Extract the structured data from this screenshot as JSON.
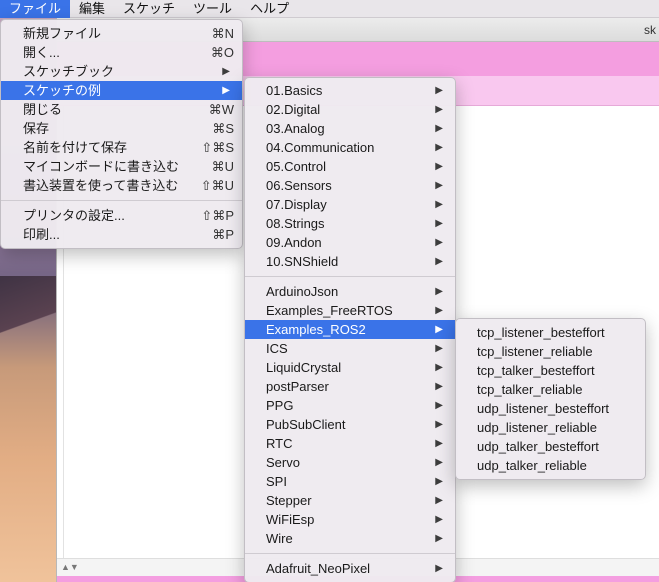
{
  "menubar": {
    "items": [
      "ファイル",
      "編集",
      "スケッチ",
      "ツール",
      "ヘルプ"
    ]
  },
  "ide": {
    "title": "sk"
  },
  "scrollbar": {
    "arrows": "▲▼"
  },
  "file_menu": {
    "items": [
      {
        "label": "新規ファイル",
        "shortcut": "⌘N"
      },
      {
        "label": "開く...",
        "shortcut": "⌘O"
      },
      {
        "label": "スケッチブック",
        "submenu": true
      },
      {
        "label": "スケッチの例",
        "submenu": true,
        "highlight": true
      },
      {
        "label": "閉じる",
        "shortcut": "⌘W"
      },
      {
        "label": "保存",
        "shortcut": "⌘S"
      },
      {
        "label": "名前を付けて保存",
        "shortcut": "⇧⌘S"
      },
      {
        "label": "マイコンボードに書き込む",
        "shortcut": "⌘U"
      },
      {
        "label": "書込装置を使って書き込む",
        "shortcut": "⇧⌘U"
      },
      {
        "label": "プリンタの設定...",
        "shortcut": "⇧⌘P"
      },
      {
        "label": "印刷...",
        "shortcut": "⌘P"
      }
    ]
  },
  "examples_menu": {
    "builtin": [
      "01.Basics",
      "02.Digital",
      "03.Analog",
      "04.Communication",
      "05.Control",
      "06.Sensors",
      "07.Display",
      "08.Strings",
      "09.Andon",
      "10.SNShield"
    ],
    "libraries": [
      "ArduinoJson",
      "Examples_FreeRTOS",
      "Examples_ROS2",
      "ICS",
      "LiquidCrystal",
      "postParser",
      "PPG",
      "PubSubClient",
      "RTC",
      "Servo",
      "SPI",
      "Stepper",
      "WiFiEsp",
      "Wire"
    ],
    "extra": [
      "Adafruit_NeoPixel"
    ],
    "highlighted": "Examples_ROS2"
  },
  "ros2_menu": {
    "items": [
      "tcp_listener_besteffort",
      "tcp_listener_reliable",
      "tcp_talker_besteffort",
      "tcp_talker_reliable",
      "udp_listener_besteffort",
      "udp_listener_reliable",
      "udp_talker_besteffort",
      "udp_talker_reliable"
    ]
  },
  "colors": {
    "highlight": "#3a73e8",
    "toolbar": "#f49ee0",
    "tabbar": "#f9c8ef"
  }
}
